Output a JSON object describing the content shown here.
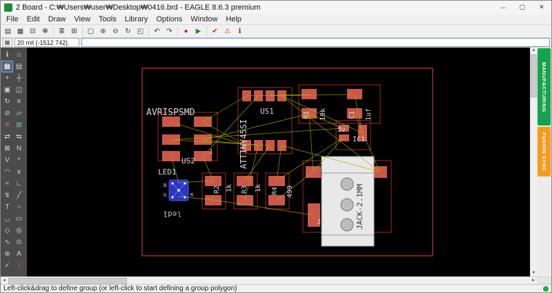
{
  "window": {
    "title": "2 Board - C:₩Users₩user₩Desktop₩0416.brd - EAGLE 8.6.3 premium",
    "controls": {
      "minimize": "─",
      "maximize": "▢",
      "close": "✕"
    }
  },
  "menu": {
    "items": [
      "File",
      "Edit",
      "Draw",
      "View",
      "Tools",
      "Library",
      "Options",
      "Window",
      "Help"
    ]
  },
  "icons": {
    "open": "▤",
    "save": "▦",
    "print": "⊟",
    "cam": "☸",
    "layers": "≣",
    "grid": "⊞",
    "zoomfit": "▢",
    "zoomin": "⊕",
    "zoomout": "⊖",
    "zoomredraw": "↻",
    "zoomselect": "◰",
    "undo": "↶",
    "redo": "↷",
    "stop": "●",
    "go": "▶",
    "drccheck": "✔",
    "errors": "⚠",
    "info": "ℹ",
    "tool_info": "ℹ",
    "tool_show": "☼",
    "tool_group": "▦",
    "tool_display": "▤",
    "tool_move": "+",
    "tool_mark": "┼",
    "tool_copy": "▣",
    "tool_mirror": "◫",
    "tool_rotate": "↻",
    "tool_change": "≡",
    "tool_cut": "⊘",
    "tool_paste": "▱",
    "tool_delete": "✕",
    "tool_add": "⊞",
    "tool_pinswap": "⇄",
    "tool_replace": "⇆",
    "tool_lock": "⊠",
    "tool_name": "N",
    "tool_value": "V",
    "tool_smash": "*",
    "tool_miter": "◠",
    "tool_split": "∨",
    "tool_optimize": "≈",
    "tool_route": "∟",
    "tool_ripup": "↯",
    "tool_wire": "╱",
    "tool_text": "T",
    "tool_circle": "○",
    "tool_arc": "◡",
    "tool_rect": "▭",
    "tool_polygon": "◇",
    "tool_via": "◎",
    "tool_signal": "∿",
    "tool_hole": "⊙",
    "tool_ratsnest": "⊛",
    "tool_auto": "A",
    "tool_drc": "✓",
    "tool_erc": "!",
    "scroll_up": "▲",
    "scroll_down": "▼",
    "scroll_left": "◄",
    "scroll_right": "►",
    "gridbtn": "▦"
  },
  "params": {
    "grid_readout": "20 mil (-1512 742)",
    "command_value": ""
  },
  "sidebar_tabs": {
    "manufacturing": "MANUFACTURING",
    "fusion": "FUSION SYNC"
  },
  "statusbar": {
    "text": "Left-click&drag to define group (or left-click to start defining a group polygon)"
  },
  "pcb": {
    "labels": {
      "avrisp": "AVRISPSMD",
      "us1": "US1",
      "attiny": "ATTINY45SI",
      "us2": "US2",
      "pin1": "1",
      "r1": "R1",
      "r1val": "10k",
      "c1": "C1",
      "c1val": "1uf",
      "v5": "5v",
      "ic1": "IC1",
      "led1": "LED1",
      "led1b": "led1",
      "b": "B",
      "g": "G",
      "r": "R",
      "r2": "R2",
      "r2val": "1k",
      "r3": "R3",
      "r3val": "1k",
      "r4": "R4",
      "r4val": "499",
      "jack": "JACK-2.1MM",
      "j1": "J1"
    },
    "colors": {
      "board": "#c83737",
      "pad": "#c9584a",
      "airwire": "#a8b400",
      "silk": "#d8d8d8"
    }
  }
}
